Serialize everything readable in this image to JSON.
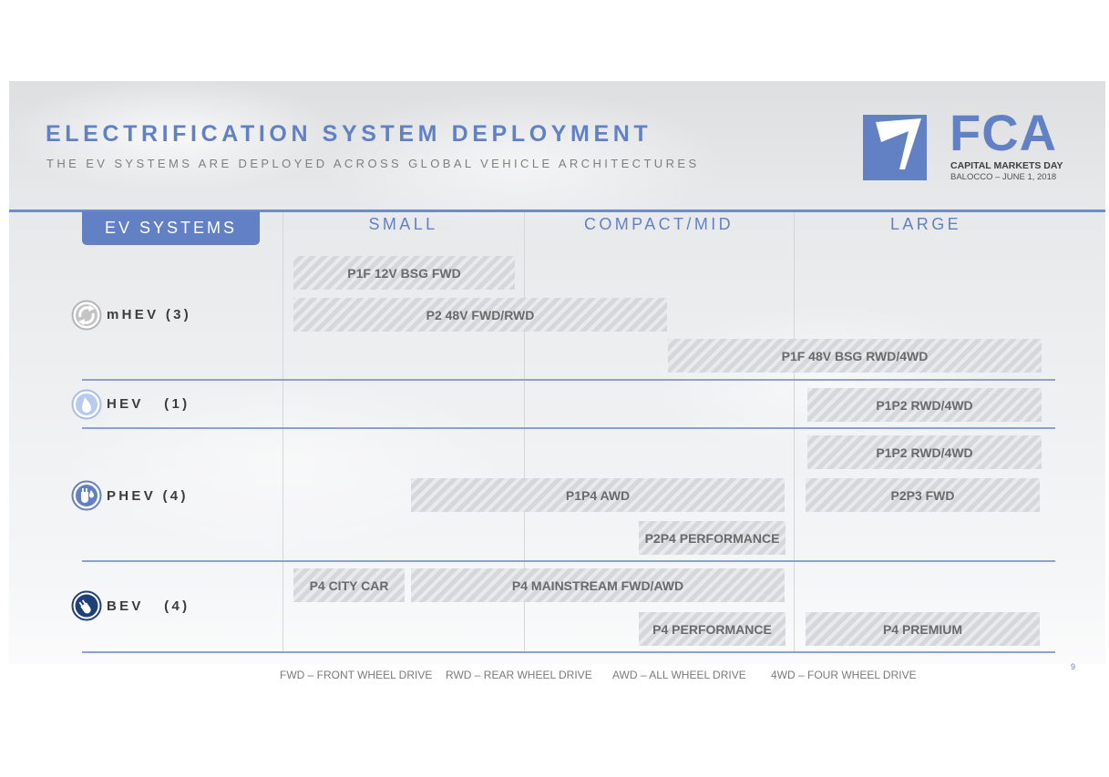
{
  "header": {
    "title": "ELECTRIFICATION SYSTEM DEPLOYMENT",
    "subtitle": "THE EV SYSTEMS ARE DEPLOYED ACROSS GLOBAL VEHICLE ARCHITECTURES"
  },
  "logo": {
    "brand": "FCA",
    "event": "CAPITAL MARKETS DAY",
    "location_date": "BALOCCO – JUNE 1, 2018"
  },
  "table": {
    "ev_systems_label": "EV SYSTEMS",
    "columns": [
      "SMALL",
      "COMPACT/MID",
      "LARGE"
    ],
    "rows": [
      {
        "label": "mHEV (3)",
        "icon": "recycle-icon"
      },
      {
        "label": "HEV   (1)",
        "icon": "drop-icon"
      },
      {
        "label": "PHEV (4)",
        "icon": "plug-drop-icon"
      },
      {
        "label": "BEV   (4)",
        "icon": "plug-icon"
      }
    ],
    "systems": [
      "P1F 12V BSG FWD",
      "P2 48V FWD/RWD",
      "P1F 48V BSG RWD/4WD",
      "P1P2 RWD/4WD",
      "P1P2 RWD/4WD",
      "P1P4 AWD",
      "P2P3 FWD",
      "P2P4 PERFORMANCE",
      "P4 CITY CAR",
      "P4 MAINSTREAM FWD/AWD",
      "P4 PERFORMANCE",
      "P4 PREMIUM"
    ]
  },
  "legend": [
    "FWD – FRONT WHEEL DRIVE",
    "RWD – REAR WHEEL DRIVE",
    "AWD – ALL WHEEL DRIVE",
    "4WD – FOUR WHEEL DRIVE"
  ],
  "page_number": "9",
  "colors": {
    "accent": "#6281c5",
    "row_label": "#3c3c3c",
    "bar_text": "#6a6a6a"
  }
}
